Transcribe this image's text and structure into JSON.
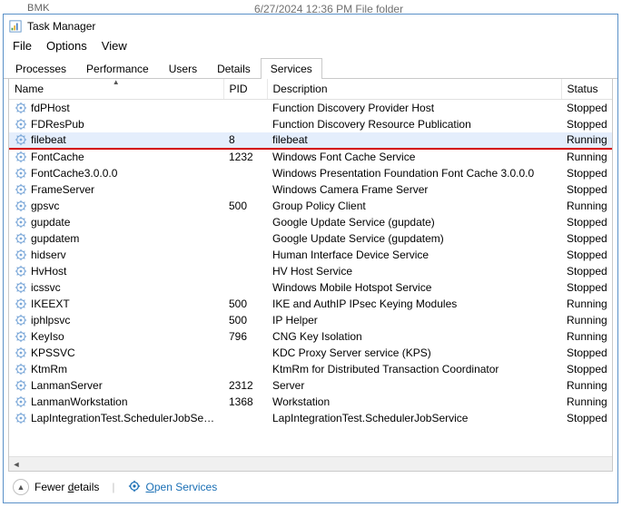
{
  "bg_hint": "BMK",
  "bg_hint2": "6/27/2024 12:36 PM     File folder",
  "window": {
    "title": "Task Manager"
  },
  "menu": {
    "file": "File",
    "options": "Options",
    "view": "View"
  },
  "tabs": [
    {
      "label": "Processes",
      "active": false
    },
    {
      "label": "Performance",
      "active": false
    },
    {
      "label": "Users",
      "active": false
    },
    {
      "label": "Details",
      "active": false
    },
    {
      "label": "Services",
      "active": true
    }
  ],
  "columns": {
    "name": "Name",
    "pid": "PID",
    "desc": "Description",
    "status": "Status"
  },
  "services": [
    {
      "name": "fdPHost",
      "pid": "",
      "desc": "Function Discovery Provider Host",
      "status": "Stopped"
    },
    {
      "name": "FDResPub",
      "pid": "",
      "desc": "Function Discovery Resource Publication",
      "status": "Stopped"
    },
    {
      "name": "filebeat",
      "pid": "8",
      "desc": "filebeat",
      "status": "Running",
      "highlight": true
    },
    {
      "name": "FontCache",
      "pid": "1232",
      "desc": "Windows Font Cache Service",
      "status": "Running"
    },
    {
      "name": "FontCache3.0.0.0",
      "pid": "",
      "desc": "Windows Presentation Foundation Font Cache 3.0.0.0",
      "status": "Stopped"
    },
    {
      "name": "FrameServer",
      "pid": "",
      "desc": "Windows Camera Frame Server",
      "status": "Stopped"
    },
    {
      "name": "gpsvc",
      "pid": "500",
      "desc": "Group Policy Client",
      "status": "Running"
    },
    {
      "name": "gupdate",
      "pid": "",
      "desc": "Google Update Service (gupdate)",
      "status": "Stopped"
    },
    {
      "name": "gupdatem",
      "pid": "",
      "desc": "Google Update Service (gupdatem)",
      "status": "Stopped"
    },
    {
      "name": "hidserv",
      "pid": "",
      "desc": "Human Interface Device Service",
      "status": "Stopped"
    },
    {
      "name": "HvHost",
      "pid": "",
      "desc": "HV Host Service",
      "status": "Stopped"
    },
    {
      "name": "icssvc",
      "pid": "",
      "desc": "Windows Mobile Hotspot Service",
      "status": "Stopped"
    },
    {
      "name": "IKEEXT",
      "pid": "500",
      "desc": "IKE and AuthIP IPsec Keying Modules",
      "status": "Running"
    },
    {
      "name": "iphlpsvc",
      "pid": "500",
      "desc": "IP Helper",
      "status": "Running"
    },
    {
      "name": "KeyIso",
      "pid": "796",
      "desc": "CNG Key Isolation",
      "status": "Running"
    },
    {
      "name": "KPSSVC",
      "pid": "",
      "desc": "KDC Proxy Server service (KPS)",
      "status": "Stopped"
    },
    {
      "name": "KtmRm",
      "pid": "",
      "desc": "KtmRm for Distributed Transaction Coordinator",
      "status": "Stopped"
    },
    {
      "name": "LanmanServer",
      "pid": "2312",
      "desc": "Server",
      "status": "Running"
    },
    {
      "name": "LanmanWorkstation",
      "pid": "1368",
      "desc": "Workstation",
      "status": "Running"
    },
    {
      "name": "LapIntegrationTest.SchedulerJobService",
      "pid": "",
      "desc": "LapIntegrationTest.SchedulerJobService",
      "status": "Stopped"
    }
  ],
  "footer": {
    "fewer_pre": "Fewer ",
    "fewer_u": "d",
    "fewer_post": "etails",
    "open_pre": "",
    "open_u": "O",
    "open_post": "pen Services"
  }
}
